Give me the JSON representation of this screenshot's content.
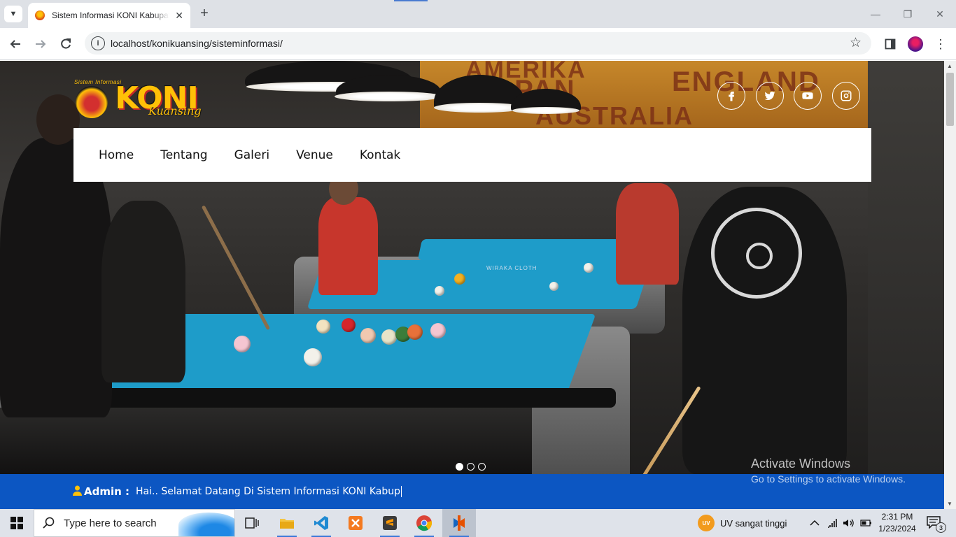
{
  "browser": {
    "tab_title": "Sistem Informasi KONI Kabupaten Kuansing",
    "url": "localhost/konikuansing/sisteminformasi/"
  },
  "site": {
    "logo": {
      "arch_text": "Sistem Informasi",
      "wordmark": "KONI",
      "script_text": "Kuansing"
    },
    "social": [
      {
        "name": "facebook",
        "icon": "facebook-icon"
      },
      {
        "name": "twitter",
        "icon": "twitter-icon"
      },
      {
        "name": "youtube",
        "icon": "youtube-icon"
      },
      {
        "name": "instagram",
        "icon": "instagram-icon"
      }
    ],
    "nav": [
      {
        "label": "Home"
      },
      {
        "label": "Tentang"
      },
      {
        "label": "Galeri"
      },
      {
        "label": "Venue"
      },
      {
        "label": "Kontak"
      }
    ],
    "hero": {
      "banner_words": [
        "AMERIKA",
        "JAPAN",
        "ENGLAND",
        "AUSTRALIA"
      ],
      "table_label": "WIRAKA CLOTH",
      "slides": 3,
      "active_slide": 1
    },
    "ticker": {
      "label": "Admin :",
      "message": "Hai.. Selamat Datang Di Sistem Informasi KONI Kabup"
    }
  },
  "watermark": {
    "line1": "Activate Windows",
    "line2": "Go to Settings to activate Windows."
  },
  "taskbar": {
    "search_placeholder": "Type here to search",
    "weather_badge": "UV",
    "weather_text": "UV sangat tinggi",
    "time": "2:31 PM",
    "date": "1/23/2024",
    "notification_count": "3"
  },
  "colors": {
    "ticker_bg": "#0c56c2",
    "logo_yellow": "#ffc107",
    "table_felt": "#1e9cc9"
  }
}
